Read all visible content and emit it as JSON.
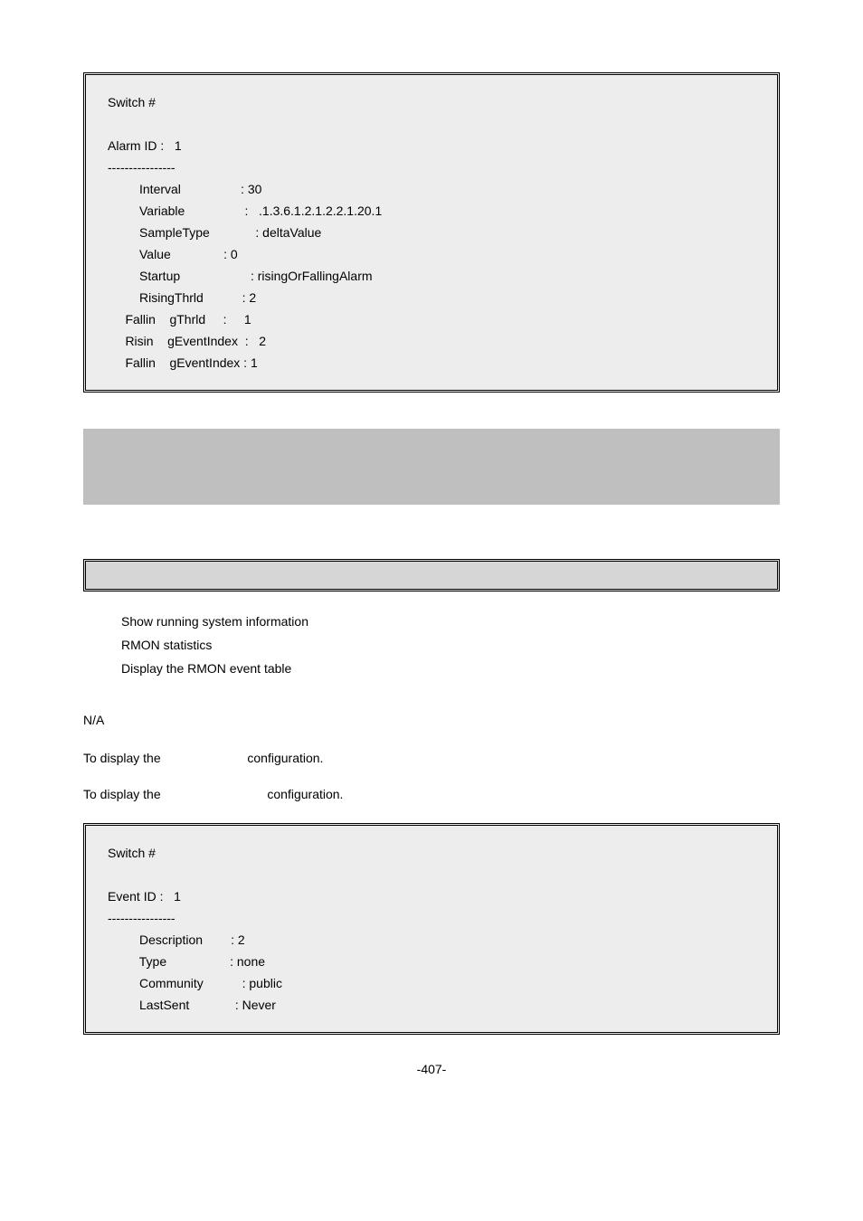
{
  "box1": {
    "prompt": "Switch #",
    "header": "Alarm ID :   1",
    "dashes": "----------------",
    "rows": [
      "         Interval                 : 30",
      "         Variable                 :   .1.3.6.1.2.1.2.2.1.20.1",
      "         SampleType             : deltaValue",
      "         Value               : 0",
      "         Startup                    : risingOrFallingAlarm",
      "         RisingThrld           : 2",
      "     Fallin    gThrld     :     1",
      "     Risin    gEventIndex  :   2",
      "     Fallin    gEventIndex : 1"
    ]
  },
  "desc": {
    "l1": "Show running system information",
    "l2": "RMON statistics",
    "l3": "Display the RMON event table"
  },
  "na": "N/A",
  "s1a": "To display the ",
  "s1b": " configuration.",
  "s2a": "To display the ",
  "s2b": " configuration.",
  "box2": {
    "prompt": "Switch #",
    "header": "Event ID :   1",
    "dashes": "----------------",
    "rows": [
      "         Description        : 2",
      "         Type                  : none",
      "         Community           : public",
      "         LastSent             : Never"
    ]
  },
  "pagenum": "-407-"
}
